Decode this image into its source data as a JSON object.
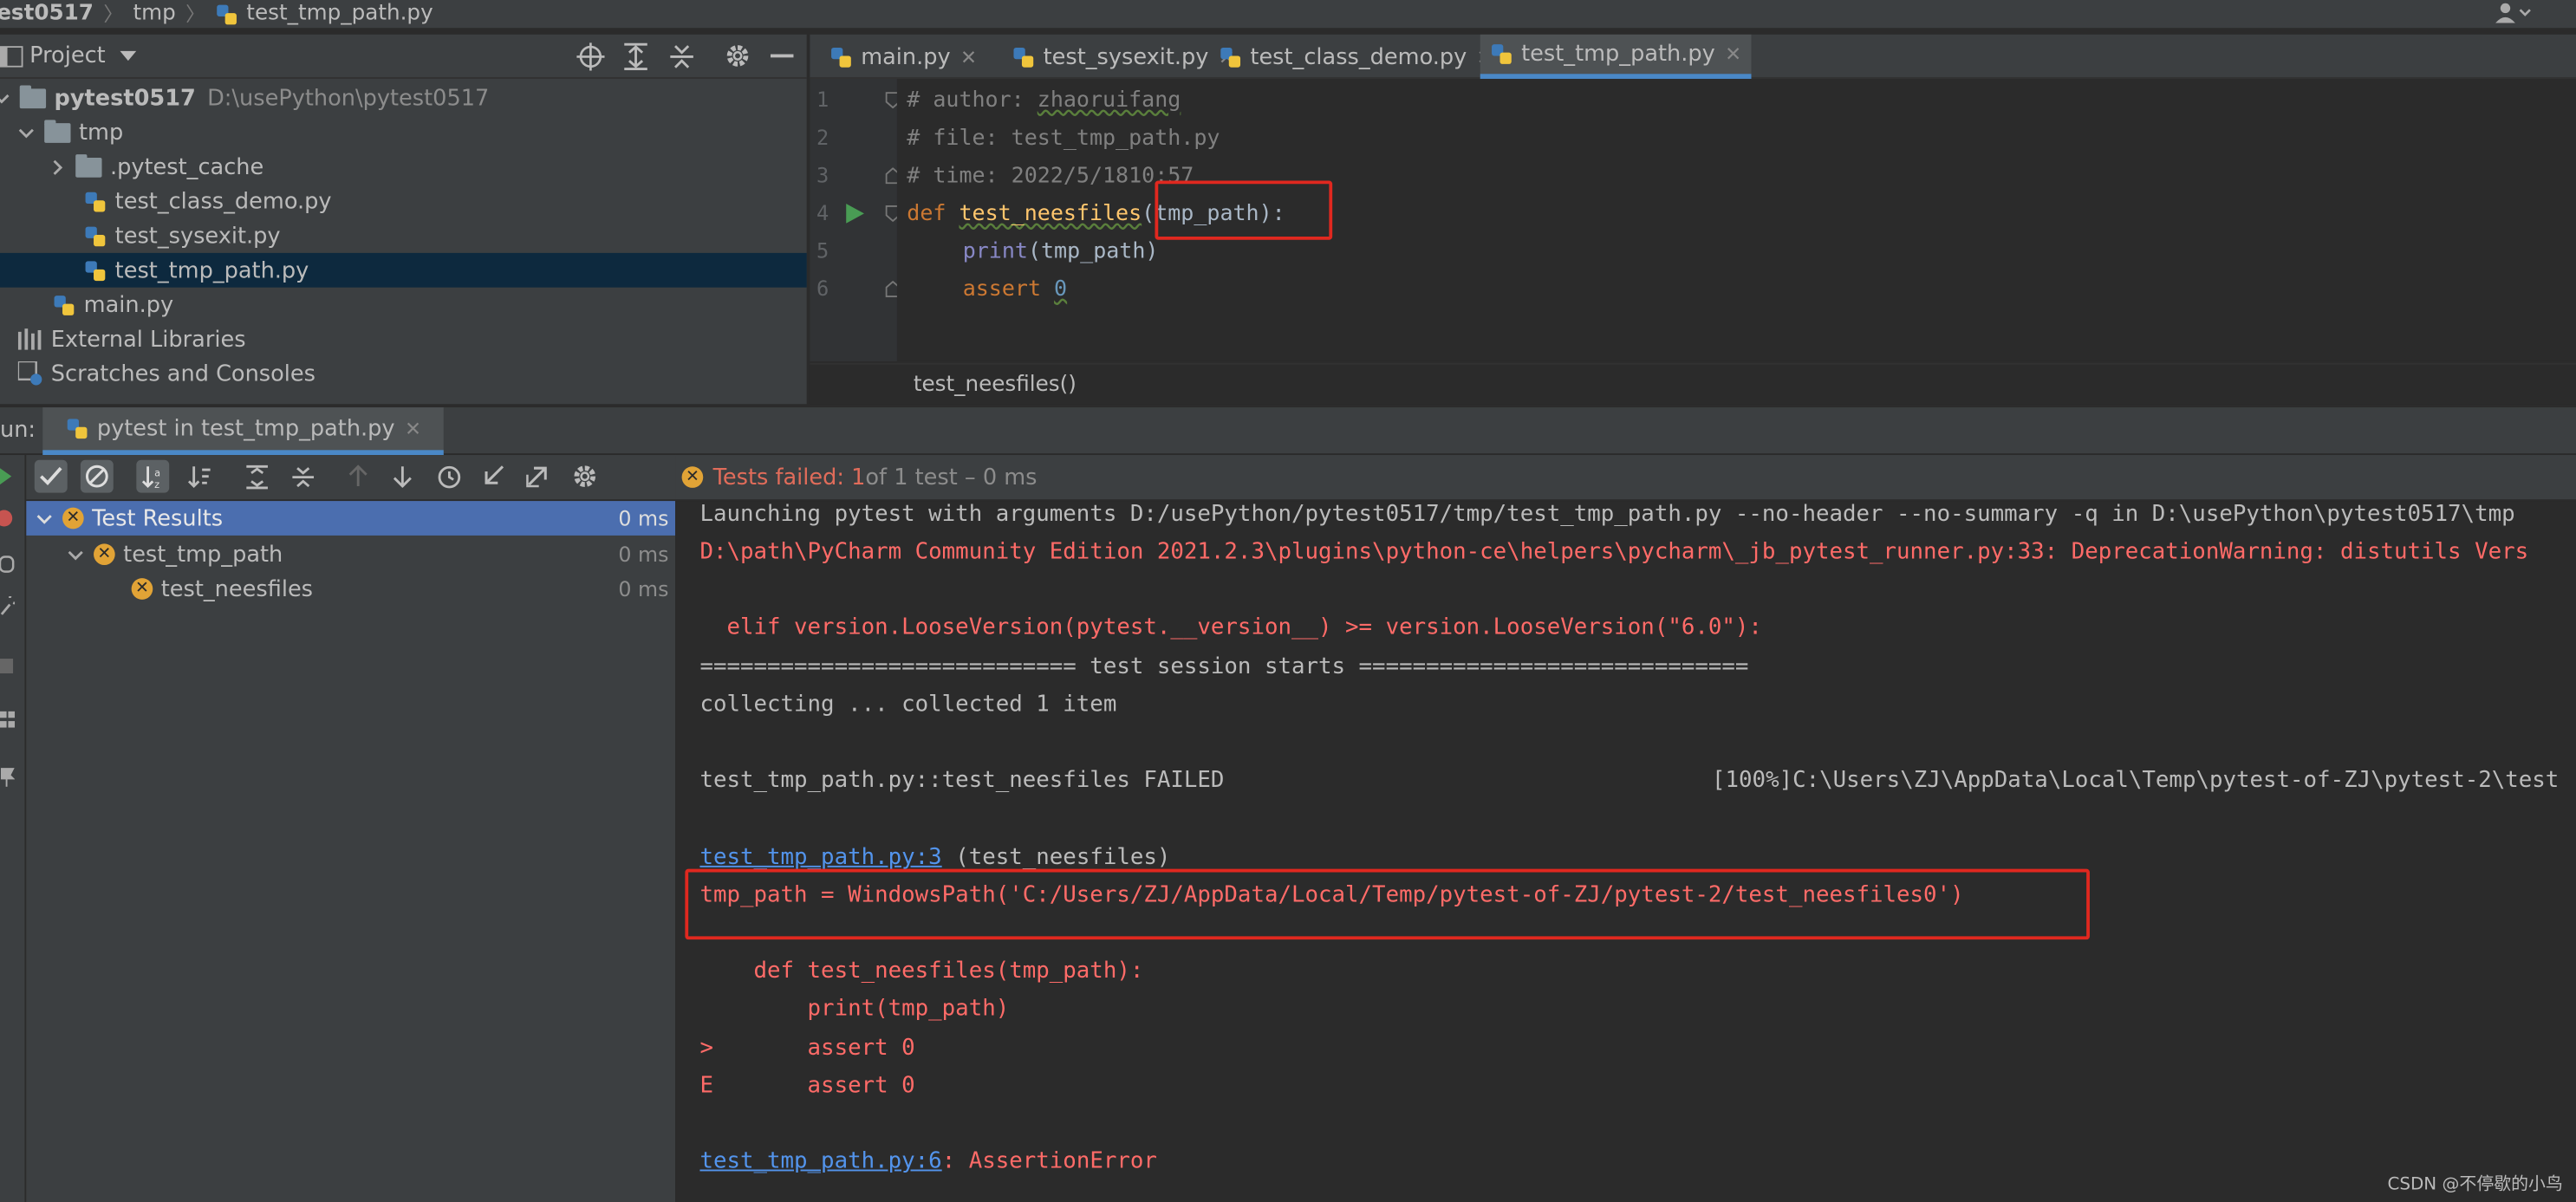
{
  "breadcrumb": {
    "root": "est0517",
    "folder": "tmp",
    "file": "test_tmp_path.py"
  },
  "project_panel": {
    "title": "Project",
    "root_name": "pytest0517",
    "root_path": "D:\\usePython\\pytest0517",
    "items": [
      {
        "label": "tmp"
      },
      {
        "label": ".pytest_cache"
      },
      {
        "label": "test_class_demo.py"
      },
      {
        "label": "test_sysexit.py"
      },
      {
        "label": "test_tmp_path.py"
      },
      {
        "label": "main.py"
      },
      {
        "label": "External Libraries"
      },
      {
        "label": "Scratches and Consoles"
      }
    ]
  },
  "editor": {
    "tabs": [
      {
        "label": "main.py"
      },
      {
        "label": "test_sysexit.py"
      },
      {
        "label": "test_class_demo.py"
      },
      {
        "label": "test_tmp_path.py"
      }
    ],
    "active_tab": "test_tmp_path.py",
    "line_numbers": [
      "1",
      "2",
      "3",
      "4",
      "5",
      "6"
    ],
    "code": {
      "l1a": "# author: ",
      "l1b": "zhaoruifang",
      "l2": "# file: test_tmp_path.py",
      "l3": "# time: 2022/5/1810:57",
      "l4_kw": "def ",
      "l4_fn": "test_neesfiles",
      "l4_rest": "(tmp_path):",
      "l5_bi": "print",
      "l5_rest": "(tmp_path)",
      "l6_kw": "assert ",
      "l6_num": "0"
    },
    "breadcrumb": "test_neesfiles()"
  },
  "run": {
    "label": "un:",
    "tab": "pytest in test_tmp_path.py",
    "status_prefix": "Tests failed: 1",
    "status_suffix": " of 1 test – 0 ms",
    "results": [
      {
        "label": "Test Results",
        "time": "0 ms"
      },
      {
        "label": "test_tmp_path",
        "time": "0 ms"
      },
      {
        "label": "test_neesfiles",
        "time": "0 ms"
      }
    ],
    "console": {
      "l1": "Launching pytest with arguments D:/usePython/pytest0517/tmp/test_tmp_path.py --no-header --no-summary -q in D:\\usePython\\pytest0517\\tmp",
      "l2": "D:\\path\\PyCharm Community Edition 2021.2.3\\plugins\\python-ce\\helpers\\pycharm\\_jb_pytest_runner.py:33: DeprecationWarning: distutils Vers",
      "l3": "  elif version.LooseVersion(pytest.__version__) >= version.LooseVersion(\"6.0\"):",
      "l4": "============================ test session starts =============================",
      "l5": "collecting ... collected 1 item",
      "l6a": "test_tmp_path.py::test_neesfiles FAILED",
      "l6b": "[100%]C:\\Users\\ZJ\\AppData\\Local\\Temp\\pytest-of-ZJ\\pytest-2\\test",
      "l7a": "test_tmp_path.py:3",
      "l7b": " (test_neesfiles)",
      "l8": "tmp_path = WindowsPath('C:/Users/ZJ/AppData/Local/Temp/pytest-of-ZJ/pytest-2/test_neesfiles0')",
      "l9": "    def test_neesfiles(tmp_path):",
      "l10": "        print(tmp_path)",
      "l11": ">       assert 0",
      "l12": "E       assert 0",
      "l13a": "test_tmp_path.py:6",
      "l13b": ": AssertionError"
    }
  },
  "watermark": "CSDN @不停歇的小鸟",
  "colors": {
    "accent": "#4a88c7",
    "error": "#ff6b68",
    "highlight_box": "#e0281f",
    "fail_badge": "#e1a336"
  }
}
